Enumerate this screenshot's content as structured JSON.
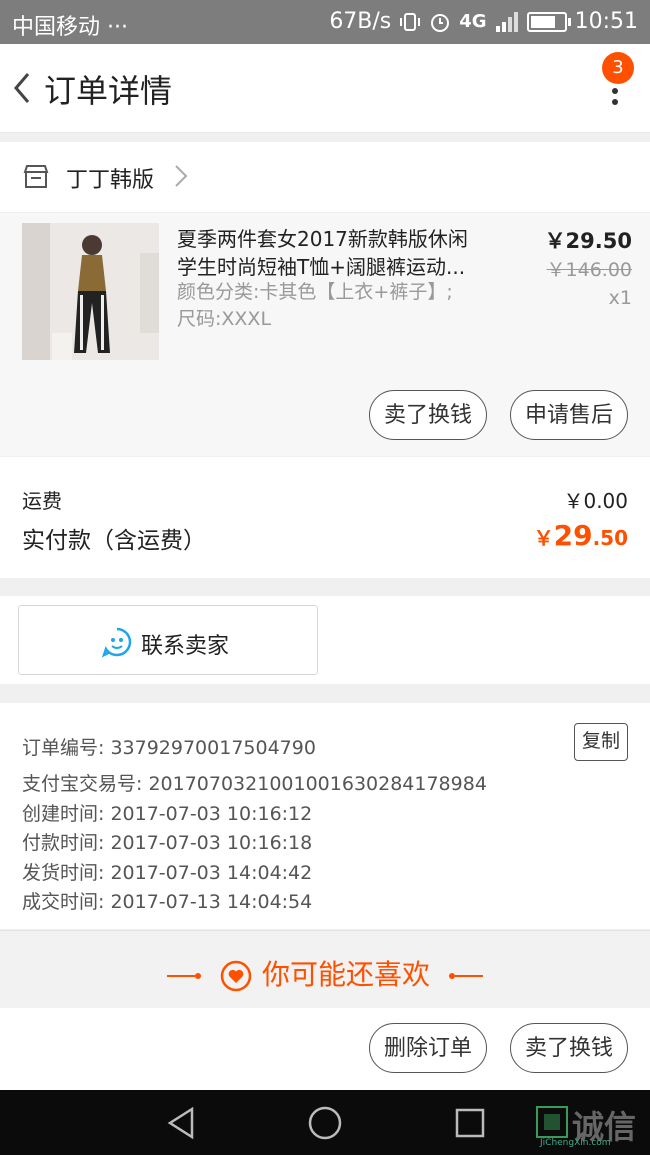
{
  "status_bar": {
    "carrier": "中国移动 ···",
    "speed": "67B/s",
    "network": "4G",
    "time": "10:51"
  },
  "header": {
    "title": "订单详情",
    "badge_count": "3"
  },
  "shop": {
    "name": "丁丁韩版"
  },
  "product": {
    "title_line1": "夏季两件套女2017新款韩版休闲",
    "title_line2": "学生时尚短袖T恤+阔腿裤运动...",
    "spec_line1": "颜色分类:卡其色【上衣+裤子】;",
    "spec_line2": "尺码:XXXL",
    "price": "￥29.50",
    "original_price": "￥146.00",
    "quantity": "x1",
    "sell_button": "卖了换钱",
    "after_sale_button": "申请售后"
  },
  "fees": {
    "shipping_label": "运费",
    "shipping_value": "￥0.00",
    "paid_label": "实付款（含运费）",
    "paid_currency": "￥",
    "paid_int": "29",
    "paid_dec": ".50"
  },
  "contact": {
    "label": "联系卖家"
  },
  "order_info": {
    "order_no": "订单编号: 33792970017504790",
    "copy_button": "复制",
    "alipay_no": "支付宝交易号: 2017070321001001630284178984",
    "created": "创建时间: 2017-07-03 10:16:12",
    "paid": "付款时间: 2017-07-03 10:16:18",
    "shipped": "发货时间: 2017-07-03 14:04:42",
    "completed": "成交时间: 2017-07-13 14:04:54"
  },
  "recommend": {
    "label": "你可能还喜欢"
  },
  "footer": {
    "delete_button": "删除订单",
    "sell_button": "卖了换钱"
  },
  "watermark": {
    "text": "诚信",
    "sub": "JiChengXin.com"
  },
  "colors": {
    "accent": "#ff5000",
    "status_bar": "#7d7d7d",
    "chat_icon": "#1ea4f0"
  }
}
